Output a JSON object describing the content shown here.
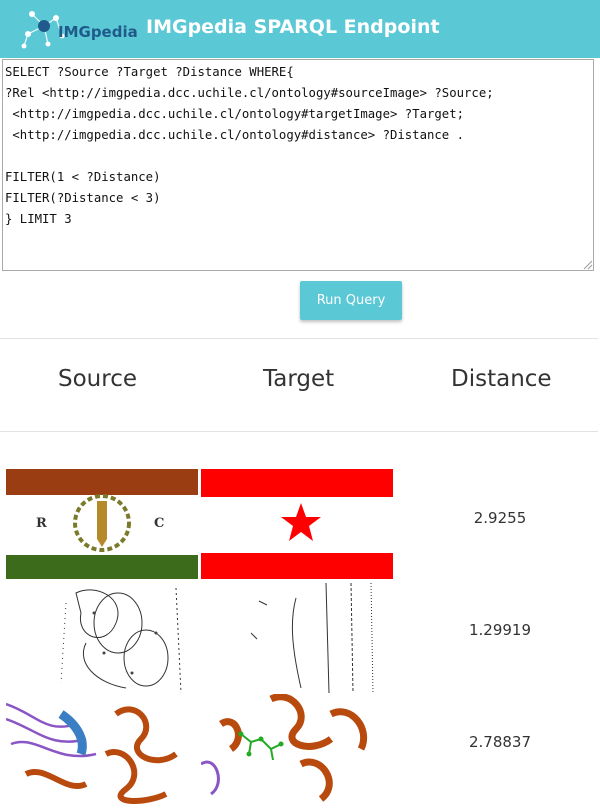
{
  "header": {
    "logo_text": "IMGpedia",
    "title": "IMGpedia SPARQL Endpoint",
    "background_color": "#5bc8d6"
  },
  "query": {
    "text": "SELECT ?Source ?Target ?Distance WHERE{\n?Rel <http://imgpedia.dcc.uchile.cl/ontology#sourceImage> ?Source;\n <http://imgpedia.dcc.uchile.cl/ontology#targetImage> ?Target;\n <http://imgpedia.dcc.uchile.cl/ontology#distance> ?Distance .\n\nFILTER(1 < ?Distance)\nFILTER(?Distance < 3)\n} LIMIT 3"
  },
  "run_button": {
    "label": "Run Query"
  },
  "results": {
    "columns": [
      "Source",
      "Target",
      "Distance"
    ],
    "rows": [
      {
        "source_image": "flag-rc-image",
        "target_image": "flag-red-star-image",
        "distance": "2.9255"
      },
      {
        "source_image": "sketch-pattern-image",
        "target_image": "sketch-texture-image",
        "distance": "1.29919"
      },
      {
        "source_image": "protein-structure-image",
        "target_image": "protein-ligand-image",
        "distance": "2.78837"
      }
    ]
  }
}
